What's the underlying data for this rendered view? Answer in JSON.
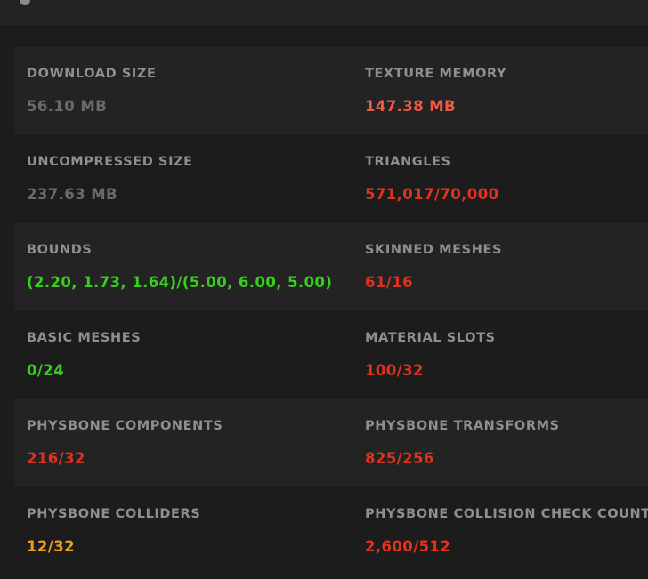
{
  "stats": [
    {
      "left": {
        "label": "DOWNLOAD SIZE",
        "value": "56.10 MB"
      },
      "right": {
        "label": "TEXTURE MEMORY",
        "value": "147.38 MB"
      }
    },
    {
      "left": {
        "label": "UNCOMPRESSED SIZE",
        "value": "237.63 MB"
      },
      "right": {
        "label": "TRIANGLES",
        "value": "571,017/70,000"
      }
    },
    {
      "left": {
        "label": "BOUNDS",
        "value": "(2.20, 1.73, 1.64)/(5.00, 6.00, 5.00)"
      },
      "right": {
        "label": "SKINNED MESHES",
        "value": "61/16"
      }
    },
    {
      "left": {
        "label": "BASIC MESHES",
        "value": "0/24"
      },
      "right": {
        "label": "MATERIAL SLOTS",
        "value": "100/32"
      }
    },
    {
      "left": {
        "label": "PHYSBONE COMPONENTS",
        "value": "216/32"
      },
      "right": {
        "label": "PHYSBONE TRANSFORMS",
        "value": "825/256"
      }
    },
    {
      "left": {
        "label": "PHYSBONE COLLIDERS",
        "value": "12/32"
      },
      "right": {
        "label": "PHYSBONE COLLISION CHECK COUNT",
        "value": "2,600/512"
      }
    }
  ],
  "colors": {
    "background": "#1c1c1c",
    "row_shade": "#232323",
    "label": "#8f8f8f",
    "neutral_value": "#6a6a6a",
    "over_limit": "#e2321c",
    "warning": "#e8a028",
    "ok": "#35d01b"
  }
}
